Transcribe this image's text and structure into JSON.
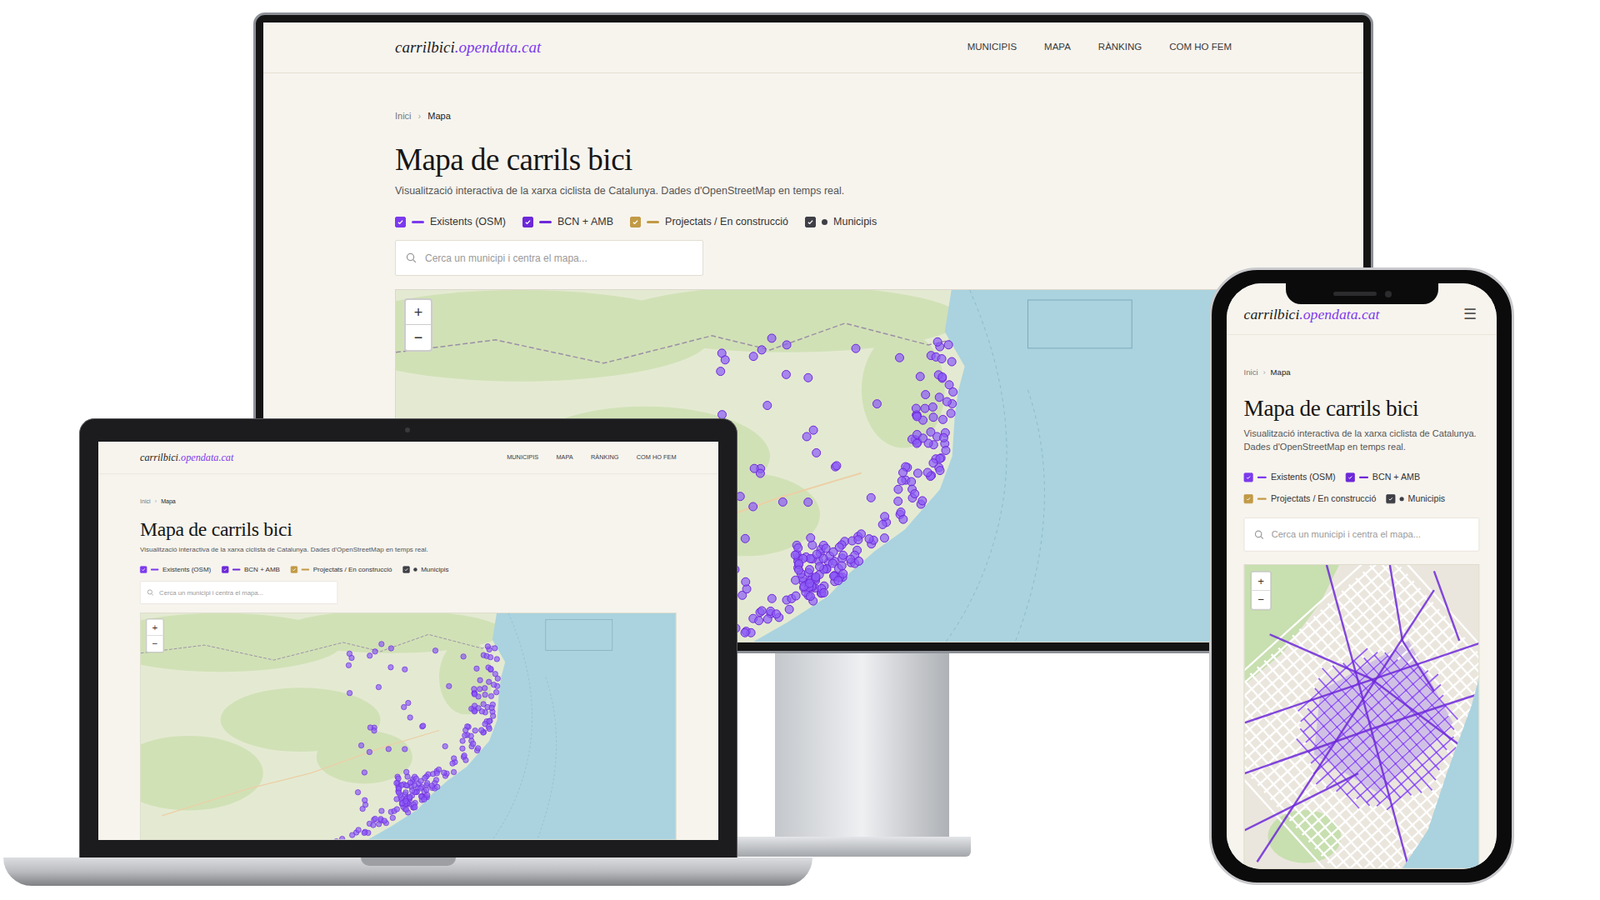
{
  "site": {
    "logo": {
      "main": "carrilbici",
      "domain": ".opendata.cat"
    },
    "nav": [
      {
        "label": "MUNICIPIS"
      },
      {
        "label": "MAPA"
      },
      {
        "label": "RÀNKING"
      },
      {
        "label": "COM HO FEM"
      }
    ],
    "menu_icon": "☰",
    "breadcrumb": {
      "items": [
        "Inici",
        "Mapa"
      ],
      "separator": "›"
    },
    "title": "Mapa de carrils bici",
    "subtitle": "Visualització interactiva de la xarxa ciclista de Catalunya. Dades d'OpenStreetMap en temps real.",
    "legend": [
      {
        "label": "Existents (OSM)",
        "checked": true,
        "color": "#7c3aed",
        "kind": "line"
      },
      {
        "label": "BCN + AMB",
        "checked": true,
        "color": "#6d28d9",
        "kind": "line"
      },
      {
        "label": "Projectats / En construcció",
        "checked": true,
        "color": "#c29a45",
        "kind": "line"
      },
      {
        "label": "Municipis",
        "checked": true,
        "color": "#3f3f46",
        "kind": "dot"
      }
    ],
    "search": {
      "placeholder": "Cerca un municipi i centra el mapa..."
    },
    "map": {
      "zoom_in": "+",
      "zoom_out": "−"
    }
  },
  "devices": [
    {
      "kind": "monitor"
    },
    {
      "kind": "laptop"
    },
    {
      "kind": "phone"
    }
  ]
}
